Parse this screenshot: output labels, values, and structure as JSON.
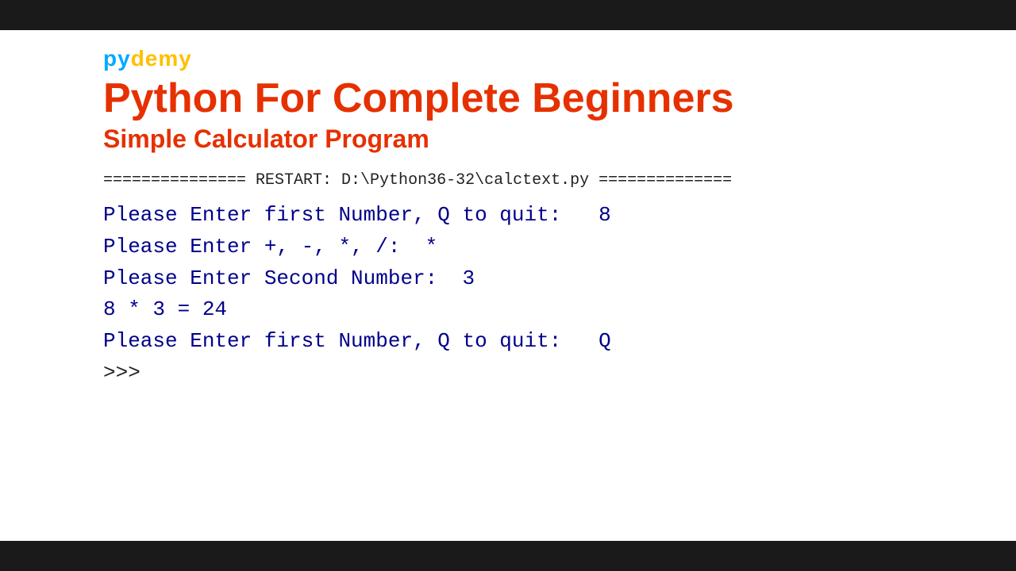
{
  "topbar": {},
  "brand": {
    "py": "py",
    "demy": "demy"
  },
  "title": {
    "main": "Python For Complete Beginners",
    "sub": "Simple Calculator Program"
  },
  "separator": "===============  RESTART: D:\\Python36-32\\calctext.py  ==============",
  "console": {
    "line1": "Please Enter first Number, Q to quit:   8",
    "line2": "Please Enter +, -, *, /:  *",
    "line3": "Please Enter Second Number:  3",
    "line4": "8 * 3 = 24",
    "line5": "Please Enter first Number, Q to quit:   Q",
    "line6": ">>> "
  },
  "bottombar": {}
}
